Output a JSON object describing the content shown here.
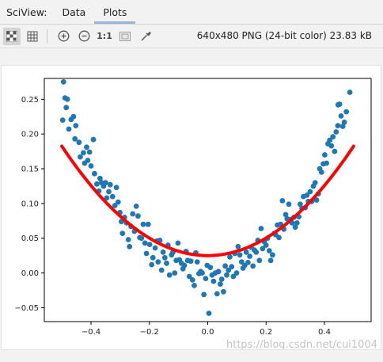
{
  "tabs": {
    "title": "SciView:",
    "items": [
      {
        "label": "Data",
        "active": false
      },
      {
        "label": "Plots",
        "active": true
      }
    ]
  },
  "toolbar": {
    "icons": [
      "checkerboard-icon",
      "grid-icon",
      "zoom-in-icon",
      "zoom-out-icon",
      "actual-size-icon",
      "fit-to-window-icon",
      "color-picker-icon"
    ],
    "actual_size_label": "1:1"
  },
  "image_info": "640x480 PNG (24-bit color) 23.83 kB",
  "watermark": "https://blog.csdn.net/cui1004",
  "chart_data": {
    "type": "scatter",
    "xlim": [
      -0.56,
      0.56
    ],
    "ylim": [
      -0.07,
      0.28
    ],
    "x_ticks": [
      -0.4,
      -0.2,
      0.0,
      0.2,
      0.4
    ],
    "x_tick_labels": [
      "−0.4",
      "−0.2",
      "0.0",
      "0.2",
      "0.4"
    ],
    "y_ticks": [
      -0.05,
      0.0,
      0.05,
      0.1,
      0.15,
      0.2,
      0.25
    ],
    "y_tick_labels": [
      "−0.05",
      "0.00",
      "0.05",
      "0.10",
      "0.15",
      "0.20",
      "0.25"
    ],
    "colors": {
      "points": "#1f77b4",
      "fit_line": "#ff0000"
    },
    "fit_line": {
      "type": "quadratic",
      "x_range": [
        -0.5,
        0.5
      ],
      "coefficients": {
        "a": 0.63,
        "b": 0.0,
        "c": 0.025
      }
    },
    "points": [
      [
        -0.494,
        0.275
      ],
      [
        -0.489,
        0.252
      ],
      [
        -0.485,
        0.238
      ],
      [
        -0.481,
        0.25
      ],
      [
        -0.497,
        0.22
      ],
      [
        -0.476,
        0.207
      ],
      [
        -0.468,
        0.221
      ],
      [
        -0.46,
        0.225
      ],
      [
        -0.452,
        0.212
      ],
      [
        -0.455,
        0.193
      ],
      [
        -0.441,
        0.188
      ],
      [
        -0.437,
        0.167
      ],
      [
        -0.426,
        0.173
      ],
      [
        -0.422,
        0.158
      ],
      [
        -0.415,
        0.181
      ],
      [
        -0.411,
        0.162
      ],
      [
        -0.405,
        0.174
      ],
      [
        -0.4,
        0.154
      ],
      [
        -0.392,
        0.192
      ],
      [
        -0.388,
        0.143
      ],
      [
        -0.38,
        0.128
      ],
      [
        -0.373,
        0.118
      ],
      [
        -0.369,
        0.136
      ],
      [
        -0.364,
        0.13
      ],
      [
        -0.357,
        0.125
      ],
      [
        -0.35,
        0.13
      ],
      [
        -0.346,
        0.108
      ],
      [
        -0.339,
        0.117
      ],
      [
        -0.334,
        0.127
      ],
      [
        -0.326,
        0.11
      ],
      [
        -0.318,
        0.097
      ],
      [
        -0.313,
        0.123
      ],
      [
        -0.307,
        0.102
      ],
      [
        -0.301,
        0.087
      ],
      [
        -0.296,
        0.074
      ],
      [
        -0.292,
        0.057
      ],
      [
        -0.285,
        0.08
      ],
      [
        -0.278,
        0.072
      ],
      [
        -0.272,
        0.048
      ],
      [
        -0.268,
        0.038
      ],
      [
        -0.263,
        0.067
      ],
      [
        -0.257,
        0.085
      ],
      [
        -0.251,
        0.06
      ],
      [
        -0.245,
        0.096
      ],
      [
        -0.239,
        0.082
      ],
      [
        -0.233,
        0.051
      ],
      [
        -0.227,
        0.05
      ],
      [
        -0.221,
        0.07
      ],
      [
        -0.215,
        0.043
      ],
      [
        -0.21,
        0.028
      ],
      [
        -0.204,
        0.07
      ],
      [
        -0.199,
        0.041
      ],
      [
        -0.192,
        0.012
      ],
      [
        -0.188,
        0.022
      ],
      [
        -0.18,
        0.036
      ],
      [
        -0.175,
        0.046
      ],
      [
        -0.17,
        0.016
      ],
      [
        -0.164,
        0.047
      ],
      [
        -0.158,
        0.004
      ],
      [
        -0.153,
        0.03
      ],
      [
        -0.147,
        0.022
      ],
      [
        -0.141,
        0.014
      ],
      [
        -0.136,
        0.04
      ],
      [
        -0.131,
        -0.003
      ],
      [
        -0.124,
        0.026
      ],
      [
        -0.119,
        0.03
      ],
      [
        -0.113,
        0.0
      ],
      [
        -0.108,
        0.018
      ],
      [
        -0.102,
        0.043
      ],
      [
        -0.097,
        0.019
      ],
      [
        -0.09,
        0.014
      ],
      [
        -0.085,
        0.006
      ],
      [
        -0.08,
        0.011
      ],
      [
        -0.074,
        0.031
      ],
      [
        -0.069,
        0.018
      ],
      [
        -0.063,
        -0.005
      ],
      [
        -0.058,
        0.017
      ],
      [
        -0.052,
        -0.01
      ],
      [
        -0.046,
        -0.018
      ],
      [
        -0.041,
        0.029
      ],
      [
        -0.036,
        0.016
      ],
      [
        -0.03,
        -0.001
      ],
      [
        -0.024,
        0.002
      ],
      [
        -0.019,
        0.0
      ],
      [
        -0.013,
        -0.031
      ],
      [
        -0.007,
        -0.008
      ],
      [
        -0.002,
        0.011
      ],
      [
        0.004,
        -0.058
      ],
      [
        0.009,
        0.008
      ],
      [
        0.015,
        -0.003
      ],
      [
        0.02,
        -0.012
      ],
      [
        0.026,
        0.0
      ],
      [
        0.032,
        -0.03
      ],
      [
        0.037,
        0.002
      ],
      [
        0.043,
        -0.016
      ],
      [
        0.048,
        -0.009
      ],
      [
        0.054,
        -0.027
      ],
      [
        0.06,
        0.01
      ],
      [
        0.065,
        -0.003
      ],
      [
        0.071,
        0.004
      ],
      [
        0.076,
        0.023
      ],
      [
        0.082,
        0.009
      ],
      [
        0.088,
        -0.005
      ],
      [
        0.093,
        0.028
      ],
      [
        0.099,
        0.0
      ],
      [
        0.104,
        0.038
      ],
      [
        0.11,
        0.026
      ],
      [
        0.116,
        0.016
      ],
      [
        0.121,
        0.007
      ],
      [
        0.127,
        0.011
      ],
      [
        0.132,
        0.03
      ],
      [
        0.138,
        0.015
      ],
      [
        0.144,
        0.024
      ],
      [
        0.149,
        0.037
      ],
      [
        0.155,
        0.01
      ],
      [
        0.16,
        0.033
      ],
      [
        0.166,
        0.03
      ],
      [
        0.172,
        0.047
      ],
      [
        0.177,
        0.018
      ],
      [
        0.183,
        0.064
      ],
      [
        0.188,
        0.035
      ],
      [
        0.194,
        0.045
      ],
      [
        0.2,
        0.04
      ],
      [
        0.205,
        0.05
      ],
      [
        0.211,
        0.032
      ],
      [
        0.216,
        0.018
      ],
      [
        0.222,
        0.026
      ],
      [
        0.228,
        0.057
      ],
      [
        0.233,
        0.055
      ],
      [
        0.239,
        0.069
      ],
      [
        0.244,
        0.051
      ],
      [
        0.25,
        0.07
      ],
      [
        0.256,
        0.104
      ],
      [
        0.261,
        0.063
      ],
      [
        0.267,
        0.084
      ],
      [
        0.272,
        0.078
      ],
      [
        0.278,
        0.099
      ],
      [
        0.284,
        0.077
      ],
      [
        0.289,
        0.072
      ],
      [
        0.295,
        0.08
      ],
      [
        0.3,
        0.066
      ],
      [
        0.306,
        0.072
      ],
      [
        0.312,
        0.081
      ],
      [
        0.317,
        0.099
      ],
      [
        0.323,
        0.093
      ],
      [
        0.328,
        0.11
      ],
      [
        0.334,
        0.094
      ],
      [
        0.34,
        0.112
      ],
      [
        0.345,
        0.103
      ],
      [
        0.351,
        0.117
      ],
      [
        0.356,
        0.103
      ],
      [
        0.362,
        0.125
      ],
      [
        0.368,
        0.13
      ],
      [
        0.373,
        0.105
      ],
      [
        0.379,
        0.114
      ],
      [
        0.384,
        0.15
      ],
      [
        0.39,
        0.145
      ],
      [
        0.396,
        0.157
      ],
      [
        0.401,
        0.17
      ],
      [
        0.407,
        0.158
      ],
      [
        0.412,
        0.186
      ],
      [
        0.418,
        0.191
      ],
      [
        0.424,
        0.183
      ],
      [
        0.429,
        0.196
      ],
      [
        0.435,
        0.175
      ],
      [
        0.44,
        0.203
      ],
      [
        0.446,
        0.212
      ],
      [
        0.452,
        0.243
      ],
      [
        0.457,
        0.226
      ],
      [
        0.463,
        0.211
      ],
      [
        0.468,
        0.217
      ],
      [
        0.475,
        0.232
      ],
      [
        0.487,
        0.26
      ],
      [
        0.447,
        0.242
      ]
    ]
  }
}
